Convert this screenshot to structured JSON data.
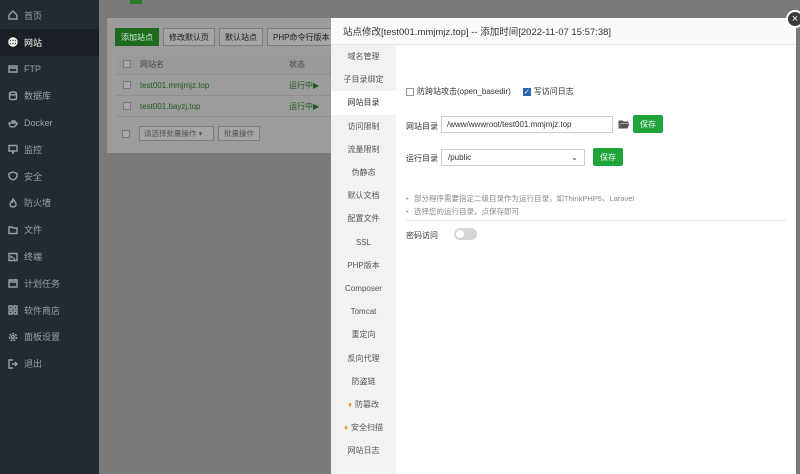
{
  "sidebar": {
    "items": [
      {
        "label": "首页",
        "icon": "home-icon"
      },
      {
        "label": "网站",
        "icon": "globe-icon",
        "active": true
      },
      {
        "label": "FTP",
        "icon": "ftp-icon"
      },
      {
        "label": "数据库",
        "icon": "database-icon"
      },
      {
        "label": "Docker",
        "icon": "docker-icon"
      },
      {
        "label": "监控",
        "icon": "monitor-icon"
      },
      {
        "label": "安全",
        "icon": "shield-icon"
      },
      {
        "label": "防火墙",
        "icon": "firewall-icon"
      },
      {
        "label": "文件",
        "icon": "folder-icon"
      },
      {
        "label": "终端",
        "icon": "terminal-icon"
      },
      {
        "label": "计划任务",
        "icon": "calendar-icon"
      },
      {
        "label": "软件商店",
        "icon": "grid-icon"
      },
      {
        "label": "面板设置",
        "icon": "gear-icon"
      },
      {
        "label": "退出",
        "icon": "logout-icon"
      }
    ]
  },
  "background": {
    "toolbar": [
      "添加站点",
      "修改默认页",
      "默认站点",
      "PHP命令行版本"
    ],
    "table_header": {
      "name": "网站名",
      "status": "状态"
    },
    "rows": [
      {
        "name": "test001.mmjmjz.top",
        "status": "运行中▶"
      },
      {
        "name": "test001.bayzj.top",
        "status": "运行中▶"
      }
    ],
    "batch_select": "请选择批量操作",
    "batch_button": "批量操作"
  },
  "modal": {
    "title": "站点修改[test001.mmjmjz.top] -- 添加时间[2022-11-07 15:57:38]",
    "close": "×",
    "tabs": [
      {
        "label": "域名管理"
      },
      {
        "label": "子目录绑定"
      },
      {
        "label": "网站目录",
        "active": true
      },
      {
        "label": "访问限制"
      },
      {
        "label": "流量限制"
      },
      {
        "label": "伪静态"
      },
      {
        "label": "默认文档"
      },
      {
        "label": "配置文件"
      },
      {
        "label": "SSL"
      },
      {
        "label": "PHP版本"
      },
      {
        "label": "Composer"
      },
      {
        "label": "Tomcat"
      },
      {
        "label": "重定向"
      },
      {
        "label": "反向代理"
      },
      {
        "label": "防盗链"
      },
      {
        "label": "防篡改",
        "gem": true
      },
      {
        "label": "安全扫描",
        "gem": true
      },
      {
        "label": "网站日志"
      }
    ],
    "options": {
      "anti_xss_label": "防跨站攻击(open_basedir)",
      "anti_xss_checked": false,
      "access_log_label": "写访问日志",
      "access_log_checked": true
    },
    "site_dir": {
      "label": "网站目录",
      "value": "/www/wwwroot/test001.mmjmjz.top",
      "save": "保存"
    },
    "run_dir": {
      "label": "运行目录",
      "value": "/public",
      "save": "保存"
    },
    "tips": [
      "部分程序需要指定二级目录作为运行目录，如ThinkPHP5，Laravel",
      "选择您的运行目录，点保存即可"
    ],
    "password_access": {
      "label": "密码访问",
      "enabled": false
    }
  },
  "colors": {
    "sidebar_bg": "#232a32",
    "accent_green": "#20a53a",
    "checkbox_blue": "#2d64b3"
  }
}
